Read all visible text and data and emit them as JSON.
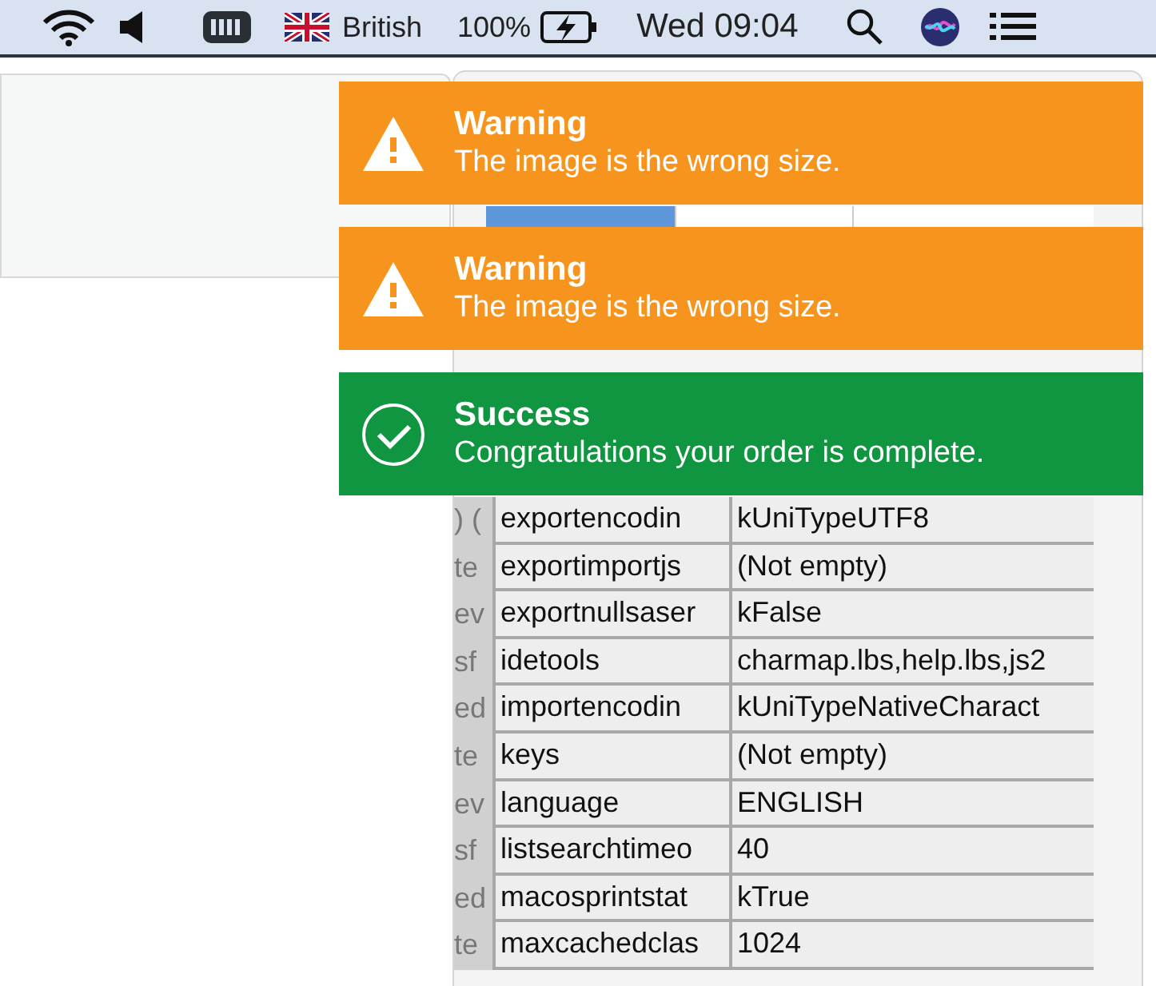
{
  "menu_bar": {
    "keyboard": "British",
    "battery": "100%",
    "clock": "Wed 09:04"
  },
  "window": {
    "side_fragments": [
      ") (",
      "te",
      "ev",
      "sf",
      "ed",
      "te",
      "ev",
      "sf",
      "ed",
      "te"
    ],
    "table": {
      "rows": [
        {
          "name": "exportencodin",
          "value": "kUniTypeUTF8"
        },
        {
          "name": "exportimportjs",
          "value": "(Not empty)"
        },
        {
          "name": "exportnullsaser",
          "value": "kFalse"
        },
        {
          "name": "idetools",
          "value": "charmap.lbs,help.lbs,js2"
        },
        {
          "name": "importencodin",
          "value": "kUniTypeNativeCharact"
        },
        {
          "name": "keys",
          "value": "(Not empty)"
        },
        {
          "name": "language",
          "value": "ENGLISH"
        },
        {
          "name": "listsearchtimeo",
          "value": "40"
        },
        {
          "name": "macosprintstat",
          "value": "kTrue"
        },
        {
          "name": "maxcachedclas",
          "value": "1024"
        }
      ]
    }
  },
  "notifications": [
    {
      "kind": "warning",
      "title": "Warning",
      "message": "The image is the wrong size."
    },
    {
      "kind": "warning",
      "title": "Warning",
      "message": "The image is the wrong size."
    },
    {
      "kind": "success",
      "title": "Success",
      "message": "Congratulations your order is complete."
    }
  ]
}
